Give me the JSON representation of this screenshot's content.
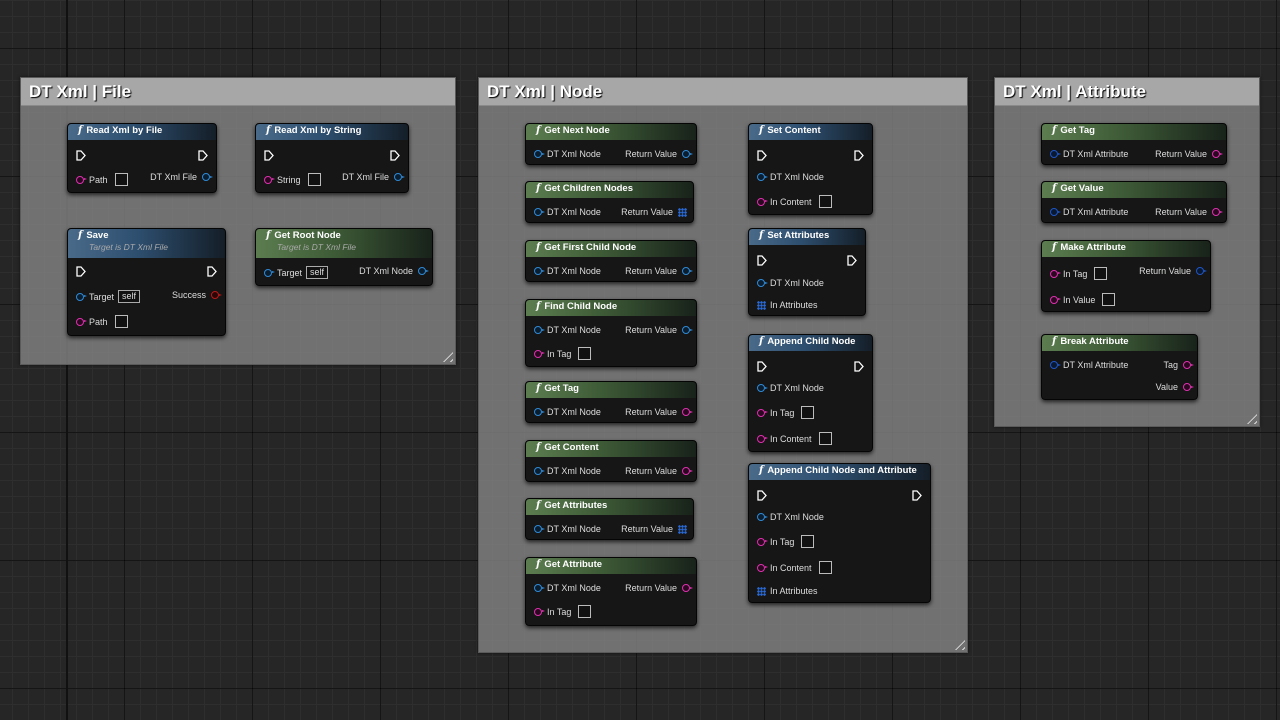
{
  "comments": {
    "file": "DT Xml | File",
    "node": "DT Xml | Node",
    "attribute": "DT Xml | Attribute"
  },
  "nodes": {
    "read_xml_by_file": {
      "title": "Read Xml by File",
      "in": "Path",
      "out": "DT Xml File"
    },
    "read_xml_by_string": {
      "title": "Read Xml by String",
      "in": "String",
      "out": "DT Xml File"
    },
    "save": {
      "title": "Save",
      "subtitle": "Target is DT Xml File",
      "target": "Target",
      "self": "self",
      "success": "Success",
      "path": "Path"
    },
    "get_root_node": {
      "title": "Get Root Node",
      "subtitle": "Target is DT Xml File",
      "target": "Target",
      "self": "self",
      "out": "DT Xml Node"
    },
    "get_next_node": {
      "title": "Get Next Node",
      "in": "DT Xml Node",
      "out": "Return Value"
    },
    "get_children_nodes": {
      "title": "Get Children Nodes",
      "in": "DT Xml Node",
      "out": "Return Value"
    },
    "get_first_child_node": {
      "title": "Get First Child Node",
      "in": "DT Xml Node",
      "out": "Return Value"
    },
    "find_child_node": {
      "title": "Find Child Node",
      "in": "DT Xml Node",
      "out": "Return Value",
      "tag": "In Tag"
    },
    "get_tag_node": {
      "title": "Get Tag",
      "in": "DT Xml Node",
      "out": "Return Value"
    },
    "get_content": {
      "title": "Get Content",
      "in": "DT Xml Node",
      "out": "Return Value"
    },
    "get_attributes": {
      "title": "Get Attributes",
      "in": "DT Xml Node",
      "out": "Return Value"
    },
    "get_attribute": {
      "title": "Get Attribute",
      "in": "DT Xml Node",
      "out": "Return Value",
      "tag": "In Tag"
    },
    "set_content": {
      "title": "Set Content",
      "in": "DT Xml Node",
      "content": "In Content"
    },
    "set_attributes": {
      "title": "Set Attributes",
      "in": "DT Xml Node",
      "attrs": "In Attributes"
    },
    "append_child_node": {
      "title": "Append Child Node",
      "in": "DT Xml Node",
      "tag": "In Tag",
      "content": "In Content"
    },
    "append_child_node_and_attribute": {
      "title": "Append Child Node and Attribute",
      "in": "DT Xml Node",
      "tag": "In Tag",
      "content": "In Content",
      "attrs": "In Attributes"
    },
    "get_tag_attr": {
      "title": "Get Tag",
      "in": "DT Xml Attribute",
      "out": "Return Value"
    },
    "get_value": {
      "title": "Get Value",
      "in": "DT Xml Attribute",
      "out": "Return Value"
    },
    "make_attribute": {
      "title": "Make Attribute",
      "tag": "In Tag",
      "value": "In Value",
      "out": "Return Value"
    },
    "break_attribute": {
      "title": "Break Attribute",
      "in": "DT Xml Attribute",
      "tag": "Tag",
      "value": "Value"
    }
  },
  "icons": {
    "function": "function-icon",
    "exec": "exec-pin-icon",
    "object_pin": "object-pin-icon",
    "string_pin": "string-pin-icon",
    "bool_pin": "bool-pin-icon",
    "array_pin": "array-pin-icon",
    "resize": "resize-grip-icon"
  },
  "colors": {
    "function_header": "#2d4e6e",
    "pure_header": "#3d5a36",
    "object_pin": "#2f8ad8",
    "string_pin": "#e02fb0",
    "bool_pin": "#bb1818",
    "array_pin": "#2a6ad8",
    "struct_pin": "#1e56c8"
  }
}
